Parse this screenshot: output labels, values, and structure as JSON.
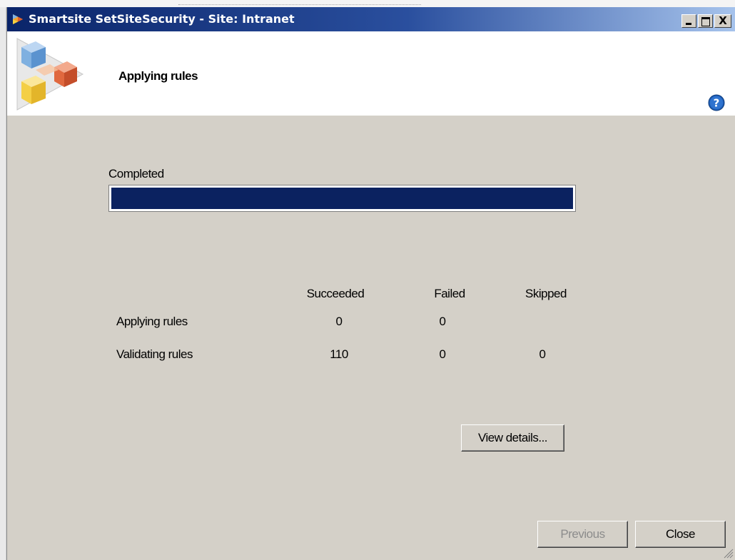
{
  "window": {
    "title": "Smartsite SetSiteSecurity - Site: Intranet",
    "controls": [
      "minimize-icon",
      "maximize-icon",
      "close-icon"
    ],
    "close_glyph": "X"
  },
  "header": {
    "title": "Applying rules",
    "help_icon": "help-icon"
  },
  "progress": {
    "label": "Completed",
    "percent": 100,
    "fill_color": "#0b2260"
  },
  "results": {
    "columns": [
      "Succeeded",
      "Failed",
      "Skipped"
    ],
    "rows": [
      {
        "label": "Applying rules",
        "succeeded": "0",
        "failed": "0",
        "skipped": ""
      },
      {
        "label": "Validating rules",
        "succeeded": "110",
        "failed": "0",
        "skipped": "0"
      }
    ]
  },
  "buttons": {
    "view_details": "View details...",
    "previous": "Previous",
    "close": "Close"
  },
  "colors": {
    "titlebar_start": "#0a2469",
    "titlebar_end": "#a6c3ec",
    "dialog_background": "#d4d0c8"
  }
}
